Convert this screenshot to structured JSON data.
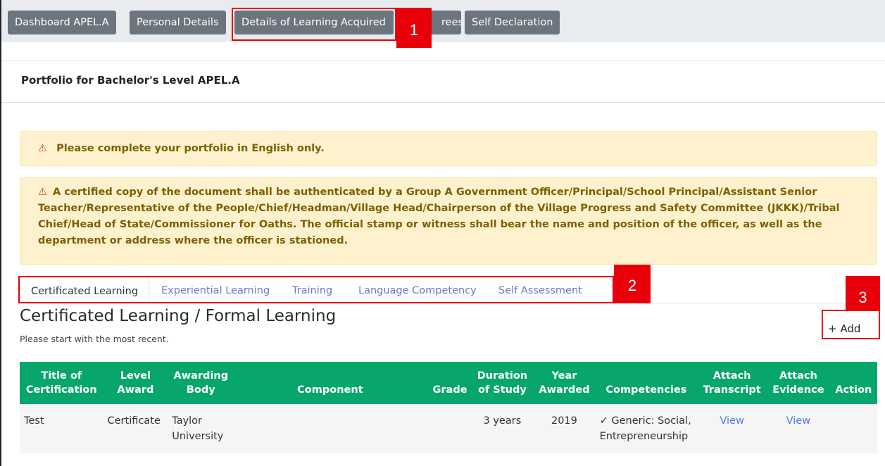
{
  "top_tabs": [
    "Dashboard APEL.A",
    "Personal Details",
    "Details of Learning Acquired",
    "Fees",
    "Self Declaration"
  ],
  "visible_fees_tab_text": "rees",
  "callouts": [
    "1",
    "2",
    "3"
  ],
  "card_title": "Portfolio for Bachelor's Level APEL.A",
  "alerts": {
    "icon": "warning-triangle-icon",
    "english_only": "Please complete your portfolio in English only.",
    "certified_copy": "A certified copy of the document shall be authenticated by a Group A Government Officer/Principal/School Principal/Assistant Senior Teacher/Representative of the People/Chief/Headman/Village Head/Chairperson of the Village Progress and Safety Committee (JKKK)/Tribal Chief/Head of State/Commissioner for Oaths. The official stamp or witness shall bear the name and position of the officer, as well as the department or address where the officer is stationed."
  },
  "sub_tabs": [
    "Certificated Learning",
    "Experiential Learning",
    "Training",
    "Language Competency",
    "Self Assessment"
  ],
  "section": {
    "title": "Certificated Learning / Formal Learning",
    "hint": "Please start with the most recent.",
    "add_label": "+ Add"
  },
  "table": {
    "headers": [
      "Title of Certification",
      "Level Award",
      "Awarding Body",
      "Component",
      "Grade",
      "Duration of Study",
      "Year Awarded",
      "Competencies",
      "Attach Transcript",
      "Attach Evidence",
      "Action"
    ],
    "rows": [
      {
        "title": "Test",
        "level": "Certificate",
        "body": "Taylor University",
        "component": "",
        "grade": "",
        "duration": "3 years",
        "year": "2019",
        "competencies": "✓ Generic: Social, Entrepreneurship",
        "transcript": "View",
        "evidence": "View",
        "action": ""
      }
    ]
  },
  "colors": {
    "accent_green": "#07a66b",
    "callout_red": "#e8000b",
    "alert_bg": "#fdf2cd",
    "tab_gray": "#6c757d",
    "link": "#4b7bd8"
  }
}
